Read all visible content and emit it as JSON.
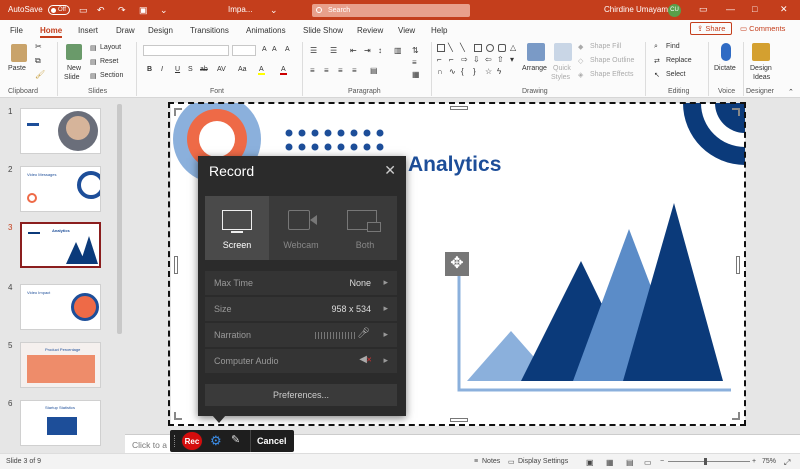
{
  "app": {
    "autosave_label": "AutoSave",
    "autosave_state": "Off",
    "doc_title": "Impa...",
    "search_placeholder": "Search",
    "user_name": "Chirdine Umayam",
    "user_initials": "CU"
  },
  "menu": {
    "tabs": [
      "File",
      "Home",
      "Insert",
      "Draw",
      "Design",
      "Transitions",
      "Animations",
      "Slide Show",
      "Review",
      "View",
      "Help"
    ],
    "active_tab": "Home",
    "share": "Share",
    "comments": "Comments"
  },
  "ribbon": {
    "groups": [
      "Clipboard",
      "Slides",
      "Font",
      "Paragraph",
      "Drawing",
      "Editing",
      "Voice",
      "Designer"
    ],
    "paste": "Paste",
    "new_slide_1": "New",
    "new_slide_2": "Slide",
    "layout": "Layout",
    "reset": "Reset",
    "section": "Section",
    "arrange": "Arrange",
    "quick_styles_1": "Quick",
    "quick_styles_2": "Styles",
    "shape_fill": "Shape Fill",
    "shape_outline": "Shape Outline",
    "shape_effects": "Shape Effects",
    "find": "Find",
    "replace": "Replace",
    "select": "Select",
    "dictate": "Dictate",
    "design_ideas_1": "Design",
    "design_ideas_2": "Ideas",
    "font_buttons": [
      "B",
      "I",
      "U",
      "S",
      "ab",
      "AV",
      "Aa",
      "A",
      "A"
    ]
  },
  "thumbnails": [
    {
      "num": "1",
      "title": ""
    },
    {
      "num": "2",
      "title": "Video Messages"
    },
    {
      "num": "3",
      "title": "Analytics"
    },
    {
      "num": "4",
      "title": "Video Impact"
    },
    {
      "num": "5",
      "title": "Product Percentage"
    },
    {
      "num": "6",
      "title": "Startup Statistics"
    }
  ],
  "selected_slide": "3",
  "slide": {
    "title": "Analytics",
    "colors": {
      "dark_blue": "#0b3a7a",
      "mid_blue": "#5b8cc8",
      "orange": "#ee6a47",
      "light_blue": "#8bb0dc"
    }
  },
  "record_panel": {
    "title": "Record",
    "modes": [
      "Screen",
      "Webcam",
      "Both"
    ],
    "active_mode": "Screen",
    "settings": [
      {
        "label": "Max Time",
        "value": "None"
      },
      {
        "label": "Size",
        "value": "958 x 534"
      },
      {
        "label": "Narration",
        "value": ""
      },
      {
        "label": "Computer Audio",
        "value": ""
      }
    ],
    "preferences": "Preferences..."
  },
  "rec_toolbar": {
    "rec": "Rec",
    "cancel": "Cancel"
  },
  "notes_placeholder": "Click to a",
  "status": {
    "slide_counter": "Slide 3 of 9",
    "notes": "Notes",
    "display_settings": "Display Settings",
    "zoom": "75%",
    "zoom_fraction": 0.45
  }
}
